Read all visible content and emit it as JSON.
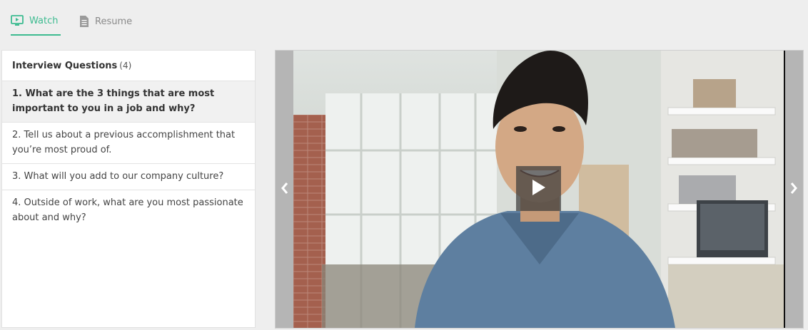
{
  "tabs": [
    {
      "label": "Watch",
      "icon": "monitor-icon",
      "active": true
    },
    {
      "label": "Resume",
      "icon": "document-icon",
      "active": false
    }
  ],
  "questions": {
    "title": "Interview Questions",
    "count": "(4)",
    "items": [
      {
        "label": "1. What are the 3 things that are most important to you in a job and why?",
        "active": true
      },
      {
        "label": "2. Tell us about a previous accomplishment that you’re most proud of.",
        "active": false
      },
      {
        "label": "3. What will you add to our company culture?",
        "active": false
      },
      {
        "label": "4. Outside of work, what are you most passionate about and why?",
        "active": false
      }
    ]
  },
  "video": {
    "prev_icon": "chevron-left-icon",
    "next_icon": "chevron-right-icon",
    "play_icon": "play-icon"
  },
  "colors": {
    "accent": "#3dbb90",
    "background": "#eeeeee",
    "active_row": "#f1f1f1"
  }
}
